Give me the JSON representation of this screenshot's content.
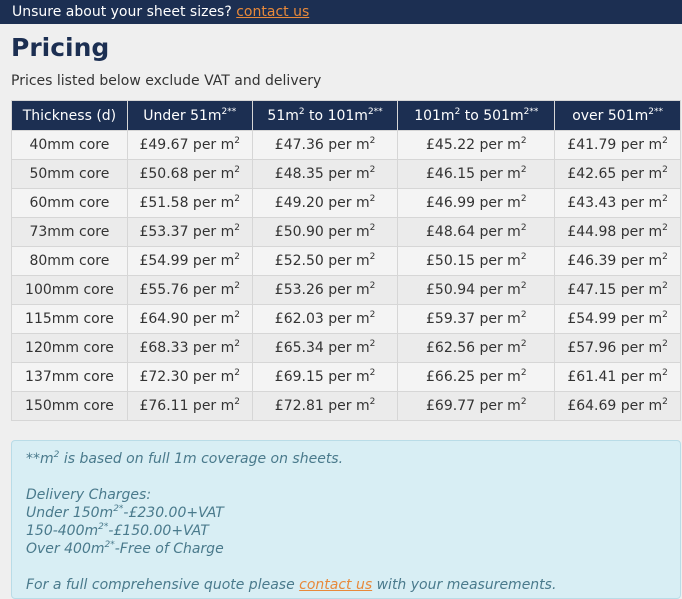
{
  "banner": {
    "text": "Unsure about your sheet sizes?",
    "link": "contact us"
  },
  "title": "Pricing",
  "subtitle": "Prices listed below exclude VAT and delivery",
  "table": {
    "headers": [
      {
        "text": "Thickness (d)",
        "sup": ""
      },
      {
        "text": "Under 51m",
        "sup": "2**"
      },
      {
        "text": "51m",
        "sup": "2",
        "text2": " to 101m",
        "sup2": "2**"
      },
      {
        "text": "101m",
        "sup": "2",
        "text2": " to 501m",
        "sup2": "2**"
      },
      {
        "text": "over 501m",
        "sup": "2**"
      }
    ],
    "unit_suffix": " per m",
    "unit_sup": "2",
    "rows": [
      {
        "thickness": "40mm core",
        "prices": [
          "£49.67",
          "£47.36",
          "£45.22",
          "£41.79"
        ]
      },
      {
        "thickness": "50mm core",
        "prices": [
          "£50.68",
          "£48.35",
          "£46.15",
          "£42.65"
        ]
      },
      {
        "thickness": "60mm core",
        "prices": [
          "£51.58",
          "£49.20",
          "£46.99",
          "£43.43"
        ]
      },
      {
        "thickness": "73mm core",
        "prices": [
          "£53.37",
          "£50.90",
          "£48.64",
          "£44.98"
        ]
      },
      {
        "thickness": "80mm core",
        "prices": [
          "£54.99",
          "£52.50",
          "£50.15",
          "£46.39"
        ]
      },
      {
        "thickness": "100mm core",
        "prices": [
          "£55.76",
          "£53.26",
          "£50.94",
          "£47.15"
        ]
      },
      {
        "thickness": "115mm core",
        "prices": [
          "£64.90",
          "£62.03",
          "£59.37",
          "£54.99"
        ]
      },
      {
        "thickness": "120mm core",
        "prices": [
          "£68.33",
          "£65.34",
          "£62.56",
          "£57.96"
        ]
      },
      {
        "thickness": "137mm core",
        "prices": [
          "£72.30",
          "£69.15",
          "£66.25",
          "£61.41"
        ]
      },
      {
        "thickness": "150mm core",
        "prices": [
          "£76.11",
          "£72.81",
          "£69.77",
          "£64.69"
        ]
      }
    ]
  },
  "note": {
    "coverage_prefix": "**m",
    "coverage_sup": "2",
    "coverage_rest": " is based on full 1m coverage on sheets.",
    "delivery_heading": "Delivery Charges:",
    "delivery": [
      {
        "prefix": "Under 150m",
        "sup": "2*",
        "rest": "-£230.00+VAT"
      },
      {
        "prefix": "150-400m",
        "sup": "2*",
        "rest": "-£150.00+VAT"
      },
      {
        "prefix": "Over 400m",
        "sup": "2*",
        "rest": "-Free of Charge"
      }
    ],
    "quote_prefix": "For a full comprehensive quote please ",
    "quote_link": "contact us",
    "quote_suffix": " with your measurements."
  }
}
